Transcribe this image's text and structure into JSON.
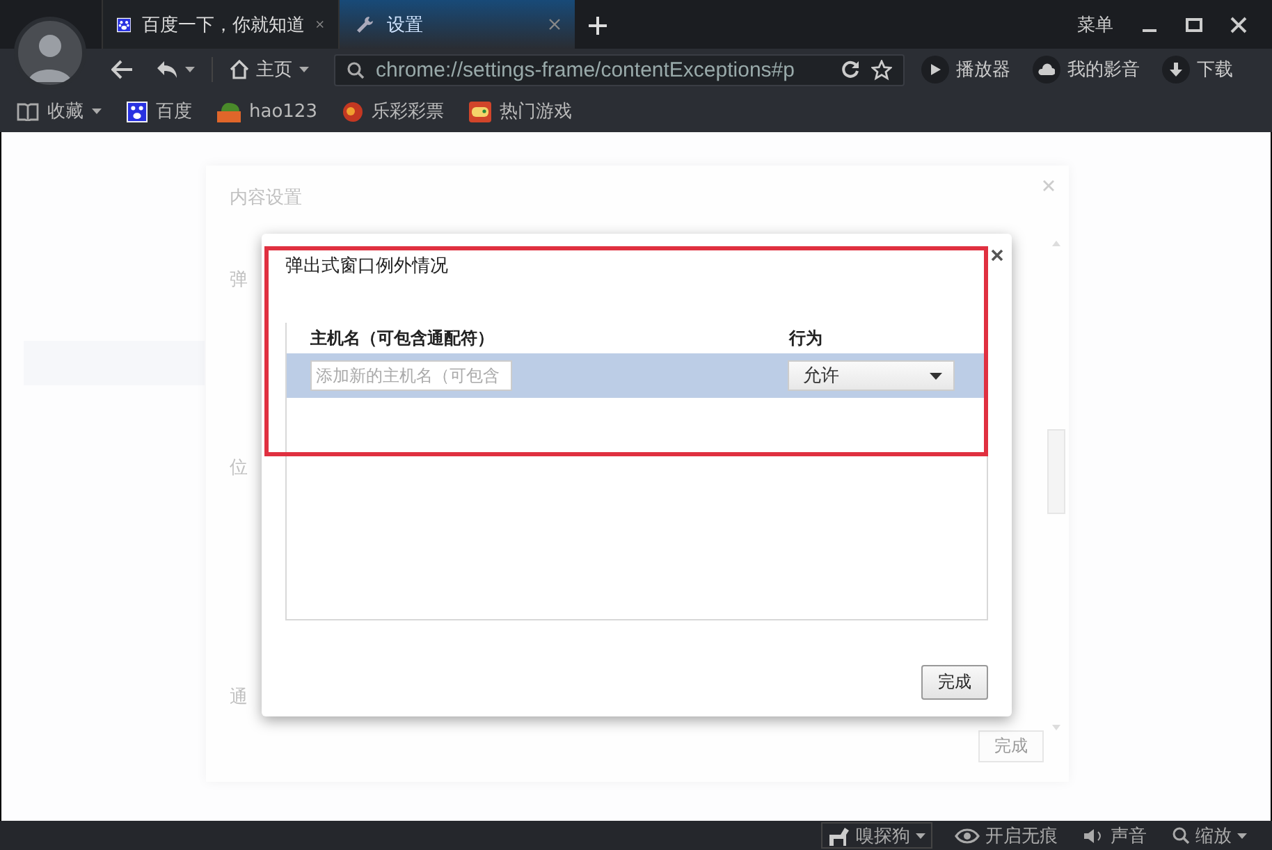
{
  "tabs": [
    {
      "label": "百度一下，你就知道",
      "selected": false
    },
    {
      "label": "设置",
      "selected": true
    }
  ],
  "menu_label": "菜单",
  "toolbar": {
    "home": "主页",
    "address": "chrome://settings-frame/contentExceptions#p",
    "buttons": [
      "播放器",
      "我的影音",
      "下载"
    ]
  },
  "bookmarks": [
    "收藏",
    "百度",
    "hao123",
    "乐彩彩票",
    "热门游戏"
  ],
  "content_settings": {
    "title": "内容设置",
    "sections": [
      "弹",
      "位",
      "通"
    ],
    "done": "完成"
  },
  "dialog": {
    "title": "弹出式窗口例外情况",
    "columns": [
      "主机名（可包含通配符）",
      "行为"
    ],
    "rows": [
      {
        "placeholder": "添加新的主机名（可包含",
        "action": "允许",
        "selected": true
      }
    ],
    "done": "完成"
  },
  "status_bar": [
    "嗅探狗",
    "开启无痕",
    "声音",
    "缩放"
  ]
}
